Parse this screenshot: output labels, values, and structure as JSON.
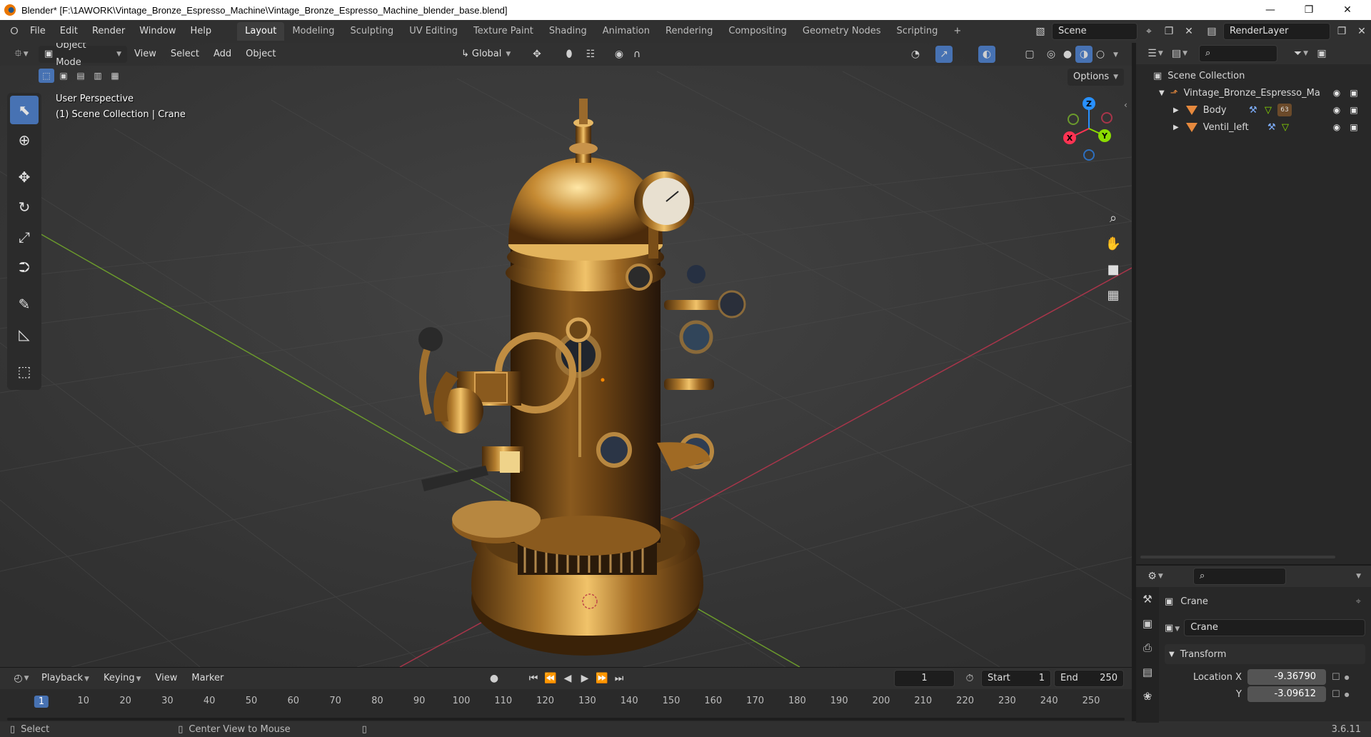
{
  "window": {
    "title": "Blender* [F:\\1AWORK\\Vintage_Bronze_Espresso_Machine\\Vintage_Bronze_Espresso_Machine_blender_base.blend]"
  },
  "menus": [
    "File",
    "Edit",
    "Render",
    "Window",
    "Help"
  ],
  "workspaces": {
    "tabs": [
      "Layout",
      "Modeling",
      "Sculpting",
      "UV Editing",
      "Texture Paint",
      "Shading",
      "Animation",
      "Rendering",
      "Compositing",
      "Geometry Nodes",
      "Scripting"
    ],
    "add": "+",
    "active": "Layout"
  },
  "scene": {
    "name": "Scene"
  },
  "view_layer": {
    "name": "RenderLayer"
  },
  "viewport": {
    "mode": "Object Mode",
    "menus": [
      "View",
      "Select",
      "Add",
      "Object"
    ],
    "transform_orientation": "Global",
    "options_label": "Options",
    "info_line1": "User Perspective",
    "info_line2": "(1) Scene Collection | Crane",
    "gizmo": {
      "x": "X",
      "y": "Y",
      "z": "Z"
    }
  },
  "tools": [
    "select-box",
    "cursor",
    "move",
    "rotate",
    "scale",
    "transform",
    "annotate",
    "measure",
    "add-cube"
  ],
  "outliner": {
    "root": "Scene Collection",
    "items": [
      {
        "label": "Vintage_Bronze_Espresso_Ma",
        "kind": "empty",
        "expanded": true
      },
      {
        "label": "Body",
        "kind": "mesh",
        "badge": "63"
      },
      {
        "label": "Ventil_left",
        "kind": "mesh"
      }
    ]
  },
  "properties": {
    "object_name": "Crane",
    "datablock_name": "Crane",
    "panel": "Transform",
    "location_x_label": "Location X",
    "location_x": "-9.36790",
    "location_y_label": "Y",
    "location_y": "-3.09612"
  },
  "timeline": {
    "menus": [
      "Playback",
      "Keying",
      "View",
      "Marker"
    ],
    "current_frame": "1",
    "start_label": "Start",
    "start": "1",
    "end_label": "End",
    "end": "250",
    "ruler": [
      "1",
      "10",
      "20",
      "30",
      "40",
      "50",
      "60",
      "70",
      "80",
      "90",
      "100",
      "110",
      "120",
      "130",
      "140",
      "150",
      "160",
      "170",
      "180",
      "190",
      "200",
      "210",
      "220",
      "230",
      "240",
      "250"
    ]
  },
  "status": {
    "left_hint": "Select",
    "middle_hint": "Center View to Mouse",
    "version": "3.6.11"
  },
  "colors": {
    "accent": "#4772b3",
    "axis_x": "#ff3352",
    "axis_y": "#8bdc00",
    "axis_z": "#2890ff",
    "object_orange": "#e6893d"
  }
}
